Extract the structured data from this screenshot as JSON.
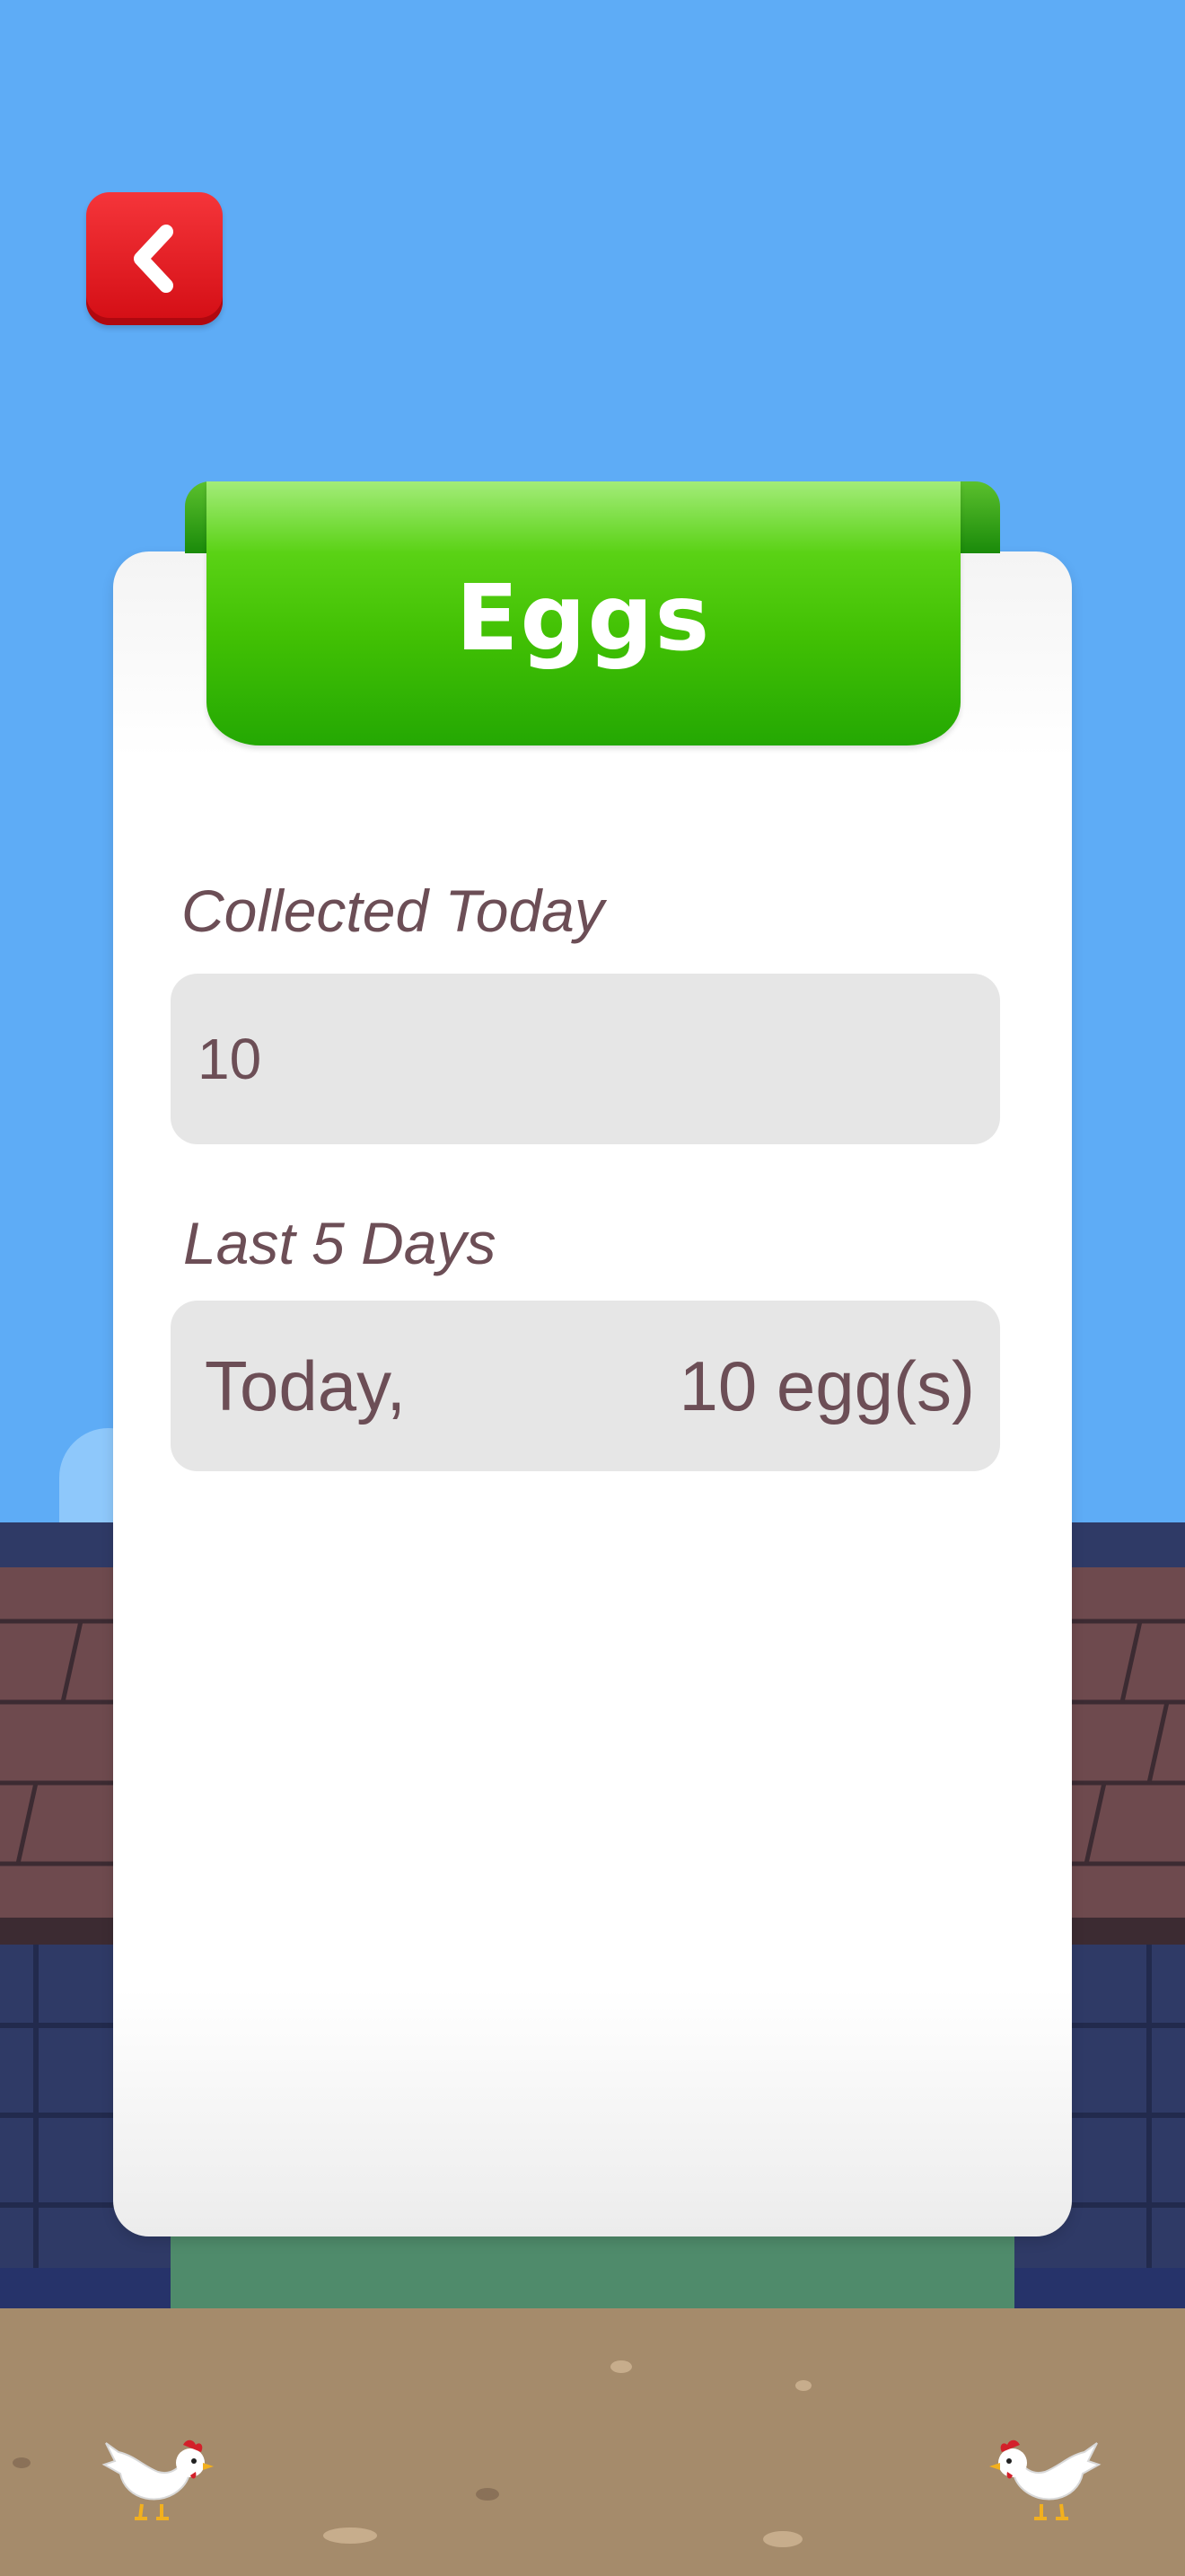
{
  "screen": {
    "title": "Eggs"
  },
  "back_button": {
    "icon": "chevron-left-icon",
    "color": "#e8141c"
  },
  "collected_today": {
    "label": "Collected Today",
    "value": "10"
  },
  "last_days": {
    "label": "Last 5 Days",
    "rows": [
      {
        "day": "Today,",
        "count": "10 egg(s)"
      }
    ]
  },
  "colors": {
    "sky": "#5eacf6",
    "ribbon": "#42c104",
    "text": "#6c4e56",
    "field_bg": "#e6e6e6"
  }
}
